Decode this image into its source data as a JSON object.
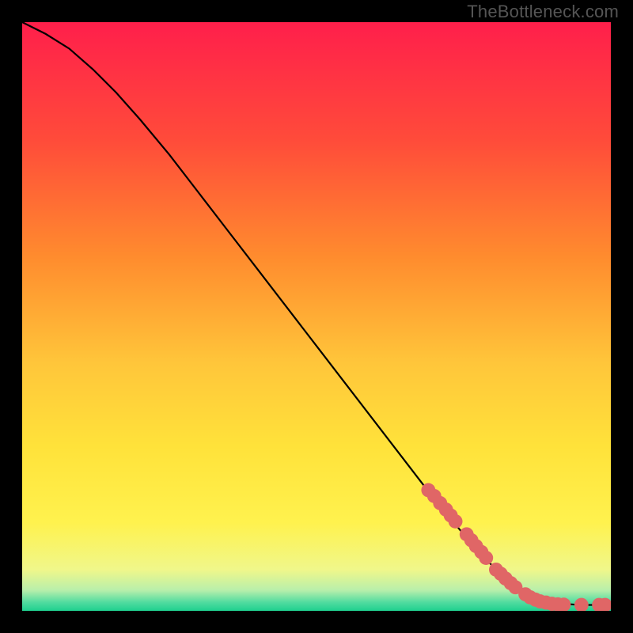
{
  "watermark": "TheBottleneck.com",
  "chart_data": {
    "type": "line",
    "title": "",
    "xlabel": "",
    "ylabel": "",
    "xlim": [
      0,
      100
    ],
    "ylim": [
      0,
      100
    ],
    "grid": false,
    "series": [
      {
        "name": "curve",
        "color": "#000000",
        "x": [
          0,
          4,
          8,
          12,
          16,
          20,
          25,
          30,
          35,
          40,
          45,
          50,
          55,
          60,
          65,
          70,
          75,
          80,
          83,
          86,
          88,
          90,
          92,
          94,
          96,
          98,
          100
        ],
        "y": [
          100,
          98,
          95.5,
          92,
          88,
          83.5,
          77.5,
          71,
          64.5,
          58,
          51.5,
          45,
          38.5,
          32,
          25.5,
          19,
          13,
          7.5,
          5,
          3,
          2,
          1.5,
          1.2,
          1.05,
          1.0,
          1.0,
          1.0
        ]
      }
    ],
    "markers": {
      "name": "highlighted-points",
      "color": "#e06666",
      "radius": 1.2,
      "points": [
        {
          "x": 69,
          "y": 20.5
        },
        {
          "x": 70,
          "y": 19.5
        },
        {
          "x": 71,
          "y": 18.3
        },
        {
          "x": 72,
          "y": 17.2
        },
        {
          "x": 72.8,
          "y": 16.2
        },
        {
          "x": 73.6,
          "y": 15.2
        },
        {
          "x": 75.5,
          "y": 13.0
        },
        {
          "x": 76.3,
          "y": 12.0
        },
        {
          "x": 77.1,
          "y": 11.0
        },
        {
          "x": 78.0,
          "y": 10.0
        },
        {
          "x": 78.8,
          "y": 9.0
        },
        {
          "x": 80.5,
          "y": 7.0
        },
        {
          "x": 81.3,
          "y": 6.3
        },
        {
          "x": 82.1,
          "y": 5.5
        },
        {
          "x": 83.0,
          "y": 4.7
        },
        {
          "x": 83.8,
          "y": 4.0
        },
        {
          "x": 85.5,
          "y": 2.8
        },
        {
          "x": 86.3,
          "y": 2.3
        },
        {
          "x": 87.2,
          "y": 1.9
        },
        {
          "x": 88.0,
          "y": 1.6
        },
        {
          "x": 89.0,
          "y": 1.4
        },
        {
          "x": 90.0,
          "y": 1.2
        },
        {
          "x": 91.0,
          "y": 1.1
        },
        {
          "x": 92.0,
          "y": 1.05
        },
        {
          "x": 95.0,
          "y": 1.0
        },
        {
          "x": 98.0,
          "y": 1.0
        },
        {
          "x": 99.0,
          "y": 1.0
        }
      ]
    },
    "background_gradient": {
      "stops": [
        {
          "offset": 0.0,
          "color": "#ff1f4b"
        },
        {
          "offset": 0.2,
          "color": "#ff4b3a"
        },
        {
          "offset": 0.4,
          "color": "#ff8c2e"
        },
        {
          "offset": 0.58,
          "color": "#ffc63a"
        },
        {
          "offset": 0.72,
          "color": "#ffe23a"
        },
        {
          "offset": 0.85,
          "color": "#fff24e"
        },
        {
          "offset": 0.93,
          "color": "#f0f78a"
        },
        {
          "offset": 0.965,
          "color": "#b8efab"
        },
        {
          "offset": 0.985,
          "color": "#53dca0"
        },
        {
          "offset": 1.0,
          "color": "#1fd18f"
        }
      ]
    }
  }
}
